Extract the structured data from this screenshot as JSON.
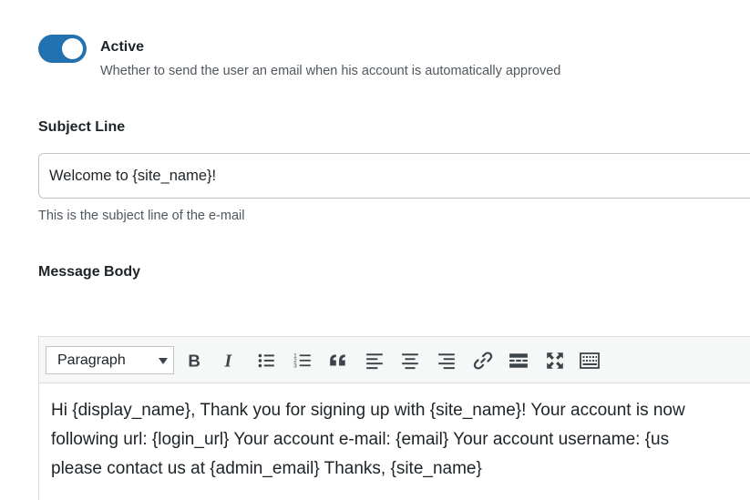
{
  "toggle": {
    "label": "Active",
    "description": "Whether to send the user an email when his account is automatically approved",
    "state": "on",
    "color": "#2271b1"
  },
  "subject": {
    "label": "Subject Line",
    "value": "Welcome to {site_name}!",
    "help": "This is the subject line of the e-mail"
  },
  "body": {
    "label": "Message Body",
    "format": "Paragraph",
    "toolbar_icons": [
      "bold-icon",
      "italic-icon",
      "bullet-list-icon",
      "numbered-list-icon",
      "blockquote-icon",
      "align-left-icon",
      "align-center-icon",
      "align-right-icon",
      "link-icon",
      "read-more-icon",
      "fullscreen-icon",
      "toolbar-toggle-icon"
    ],
    "lines": [
      "Hi {display_name}, Thank you for signing up with {site_name}! Your account is now",
      "following url: {login_url} Your account e-mail: {email} Your account username: {us",
      "please contact us at {admin_email} Thanks, {site_name}"
    ]
  }
}
